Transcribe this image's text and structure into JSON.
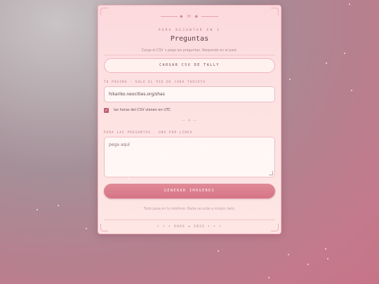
{
  "header": {
    "ornament": "◆ ✉ ◆",
    "eyebrow": "PARA REJUNTAR EN 1",
    "title": "Preguntas",
    "subtitle": "Carga el CSV o pega las preguntas. Responde en el post."
  },
  "actions": {
    "load_csv_label": "CARGAR CSV DE TALLY",
    "generate_label": "GENERAR IMÁGENES"
  },
  "page_field": {
    "label": "TU PÁGINA · SOLO EL PIE DE CADA TARJETA",
    "value": "hikariko.neocities.org/shas"
  },
  "utc_checkbox": {
    "checked": true,
    "label": "las horas del CSV vienen en UTC"
  },
  "divider": "— ✦ —",
  "questions_field": {
    "label": "PARA LAS PREGUNTAS · UNA POR LÍNEA",
    "placeholder": "pega aquí"
  },
  "privacy_note": "Todo pasa en tu teléfono. Nada se sube a ningún lado.",
  "footer": "• • • SHAS ✉ 2022 • • •",
  "colors": {
    "accent": "#d67485",
    "card_bg": "#fde2e2",
    "border": "#efb3bf"
  }
}
